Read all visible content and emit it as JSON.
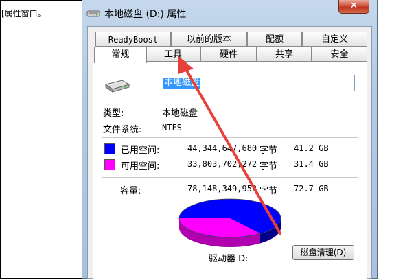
{
  "page_text": "[属性窗口。",
  "window": {
    "title": "本地磁盘 (D:) 属性",
    "close_glyph": "✕"
  },
  "tabs_row1": [
    "ReadyBoost",
    "以前的版本",
    "配额",
    "自定义"
  ],
  "tabs_row2": [
    "常规",
    "工具",
    "硬件",
    "共享",
    "安全"
  ],
  "active_tab": "常规",
  "general": {
    "volume_name": "本地磁盘",
    "type_label": "类型:",
    "type_value": "本地磁盘",
    "fs_label": "文件系统:",
    "fs_value": "NTFS",
    "used": {
      "label": "已用空间:",
      "bytes": "44,344,647,680",
      "unit": "字节",
      "size": "41.2 GB",
      "color": "#0000ff"
    },
    "free": {
      "label": "可用空间:",
      "bytes": "33,803,702,272",
      "unit": "字节",
      "size": "31.4 GB",
      "color": "#ff00ff"
    },
    "capacity": {
      "label": "容量:",
      "bytes": "78,148,349,952",
      "unit": "字节",
      "size": "72.7 GB"
    },
    "drive_label": "驱动器 D:",
    "cleanup_button": "磁盘清理(D)"
  },
  "annotation": {
    "color": "#e8403a"
  }
}
